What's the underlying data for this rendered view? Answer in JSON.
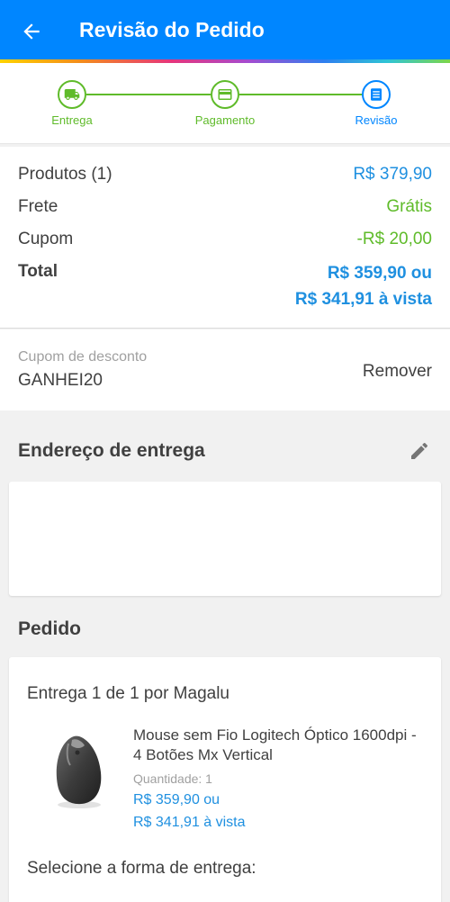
{
  "header": {
    "title": "Revisão do Pedido",
    "back_icon": "arrow-left-icon",
    "background": "#0086ff"
  },
  "stepper": {
    "steps": [
      {
        "label": "Entrega",
        "icon": "truck-icon",
        "state": "done"
      },
      {
        "label": "Pagamento",
        "icon": "credit-card-icon",
        "state": "done"
      },
      {
        "label": "Revisão",
        "icon": "receipt-icon",
        "state": "current"
      }
    ],
    "done_color": "#5fbb2a",
    "current_color": "#0086ff"
  },
  "summary": {
    "products_label": "Produtos (1)",
    "products_value": "R$ 379,90",
    "shipping_label": "Frete",
    "shipping_value": "Grátis",
    "coupon_label": "Cupom",
    "coupon_value": "-R$ 20,00",
    "total_label": "Total",
    "total_value": "R$ 359,90 ou",
    "total_cash_value": "R$ 341,91 à vista"
  },
  "coupon": {
    "caption": "Cupom de desconto",
    "code": "GANHEI20",
    "remove_label": "Remover"
  },
  "address": {
    "title": "Endereço de entrega",
    "edit_icon": "pencil-icon"
  },
  "order": {
    "title": "Pedido",
    "delivery_title": "Entrega 1 de 1 por Magalu",
    "product": {
      "name": "Mouse sem Fio Logitech Óptico 1600dpi - 4 Botões Mx Vertical",
      "quantity": "Quantidade:  1",
      "price": "R$ 359,90 ou",
      "cash_price": "R$ 341,91 à vista",
      "image": "mouse-image"
    },
    "select_delivery_label": "Selecione a forma de entrega:"
  }
}
